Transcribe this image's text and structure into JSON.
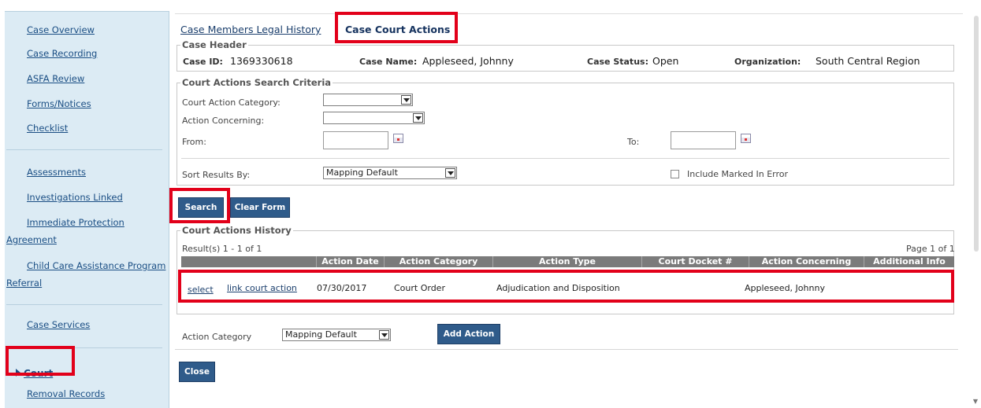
{
  "sidebar": {
    "items": [
      {
        "label": "Case Overview"
      },
      {
        "label": "Case Recording"
      },
      {
        "label": "ASFA Review"
      },
      {
        "label": "Forms/Notices"
      },
      {
        "label": "Checklist"
      },
      {
        "label": "Assessments"
      },
      {
        "label": "Investigations Linked"
      },
      {
        "label": "Immediate Protection"
      },
      {
        "label": "Agreement"
      },
      {
        "label": "Child Care Assistance Program"
      },
      {
        "label": "Referral"
      },
      {
        "label": "Case Services"
      },
      {
        "label": "Court"
      },
      {
        "label": "Removal Records"
      }
    ]
  },
  "tabs": [
    {
      "label": "Case Members Legal History"
    },
    {
      "label": "Case Court Actions"
    }
  ],
  "case_header": {
    "legend": "Case Header",
    "case_id_label": "Case ID:",
    "case_id": "1369330618",
    "case_name_label": "Case Name:",
    "case_name": "Appleseed, Johnny",
    "case_status_label": "Case Status:",
    "case_status": "Open",
    "organization_label": "Organization:",
    "organization": "South Central Region"
  },
  "search_criteria": {
    "legend": "Court Actions Search Criteria",
    "category_label": "Court Action Category:",
    "category_value": "",
    "concerning_label": "Action Concerning:",
    "concerning_value": "",
    "from_label": "From:",
    "to_label": "To:",
    "sort_label": "Sort Results By:",
    "sort_value": "Mapping Default",
    "marked_error_label": "Include Marked In Error",
    "marked_error_checked": false
  },
  "buttons": {
    "search": "Search",
    "clear": "Clear Form",
    "add_action": "Add Action",
    "close": "Close"
  },
  "history": {
    "legend": "Court Actions History",
    "results_text": "Result(s) 1 - 1 of 1",
    "page_text": "Page 1 of 1",
    "columns": [
      "Action Date",
      "Action Category",
      "Action Type",
      "Court Docket #",
      "Action Concerning",
      "Additional Info"
    ],
    "rows": [
      {
        "select": "select",
        "link": "link court action",
        "action_date": "07/30/2017",
        "action_category": "Court Order",
        "action_type": "Adjudication and Disposition",
        "court_docket": "",
        "action_concerning": "Appleseed, Johnny",
        "additional_info": ""
      }
    ]
  },
  "footer": {
    "action_category_label": "Action Category",
    "action_category_value": "Mapping Default"
  },
  "colors": {
    "highlight": "#e2001a",
    "button": "#2f5b8a",
    "sidebar_bg": "#dcebf4",
    "table_header": "#7b7b7b"
  }
}
